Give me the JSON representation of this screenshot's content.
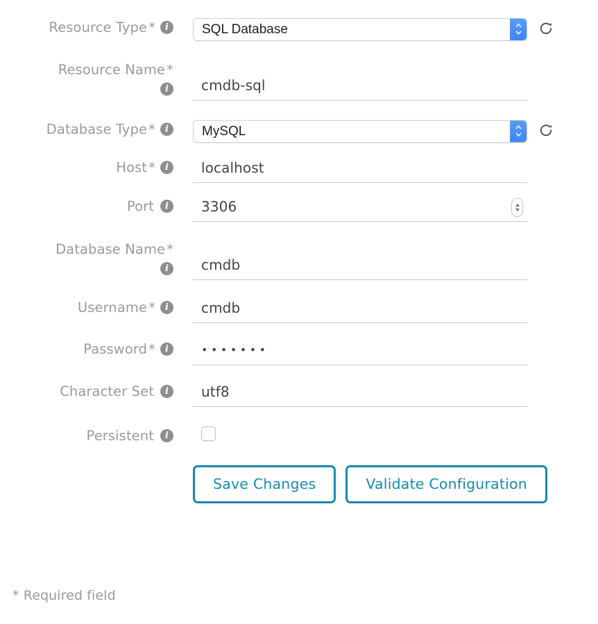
{
  "form": {
    "fields": {
      "resource_type": {
        "label": "Resource Type",
        "required_marker": "*",
        "value": "SQL Database",
        "info_icon": "info-icon",
        "refresh_icon": "refresh-icon"
      },
      "resource_name": {
        "label": "Resource Name",
        "required_marker": "*",
        "value": "cmdb-sql",
        "info_icon": "info-icon"
      },
      "database_type": {
        "label": "Database Type",
        "required_marker": "*",
        "value": "MySQL",
        "info_icon": "info-icon",
        "refresh_icon": "refresh-icon"
      },
      "host": {
        "label": "Host",
        "required_marker": "*",
        "value": "localhost",
        "info_icon": "info-icon"
      },
      "port": {
        "label": "Port",
        "required_marker": "",
        "value": "3306",
        "info_icon": "info-icon",
        "stepper_icon": "stepper-updown-icon"
      },
      "database_name": {
        "label": "Database Name",
        "required_marker": "*",
        "value": "cmdb",
        "info_icon": "info-icon"
      },
      "username": {
        "label": "Username",
        "required_marker": "*",
        "value": "cmdb",
        "info_icon": "info-icon"
      },
      "password": {
        "label": "Password",
        "required_marker": "*",
        "value": "•••••••",
        "info_icon": "info-icon"
      },
      "character_set": {
        "label": "Character Set",
        "required_marker": "",
        "value": "utf8",
        "info_icon": "info-icon"
      },
      "persistent": {
        "label": "Persistent",
        "required_marker": "",
        "checked": false,
        "info_icon": "info-icon",
        "checkbox_icon": "checkbox-unchecked-icon"
      }
    },
    "actions": {
      "save_label": "Save Changes",
      "validate_label": "Validate Configuration"
    },
    "footer_note": "* Required field",
    "colors": {
      "label_text": "#9a9a9a",
      "value_text": "#444444",
      "input_underline": "#c9c9c9",
      "button_accent": "#1789ac",
      "select_button_blue": "#4d90fe",
      "info_badge": "#8e8e8e",
      "background": "#ffffff"
    }
  }
}
